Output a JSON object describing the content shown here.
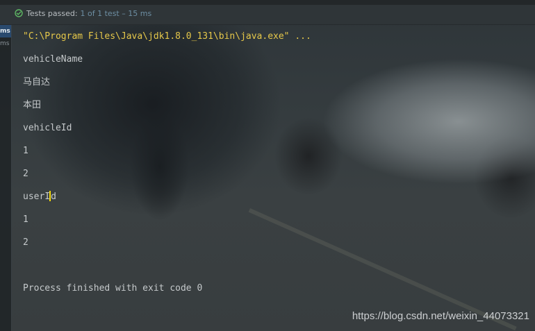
{
  "status_bar": {
    "passed_text": "Tests passed:",
    "detail_text": "1 of 1 test – 15 ms"
  },
  "gutter": {
    "selected_label": "ms",
    "other_label": "ms"
  },
  "console": {
    "command": "\"C:\\Program Files\\Java\\jdk1.8.0_131\\bin\\java.exe\" ...",
    "lines": [
      "vehicleName",
      "马自达",
      "本田",
      "vehicleId",
      "1",
      "2",
      "userId",
      "1",
      "2",
      "",
      "Process finished with exit code 0"
    ],
    "caret_line": "userId",
    "caret_prefix": "userI",
    "caret_suffix": "d"
  },
  "watermark": "https://blog.csdn.net/weixin_44073321",
  "colors": {
    "command_text": "#e6c84a",
    "output_text": "#c5c9cb",
    "caret": "#f5d90a",
    "pass_icon": "#5fb865",
    "detail_text": "#6d8ea3"
  }
}
